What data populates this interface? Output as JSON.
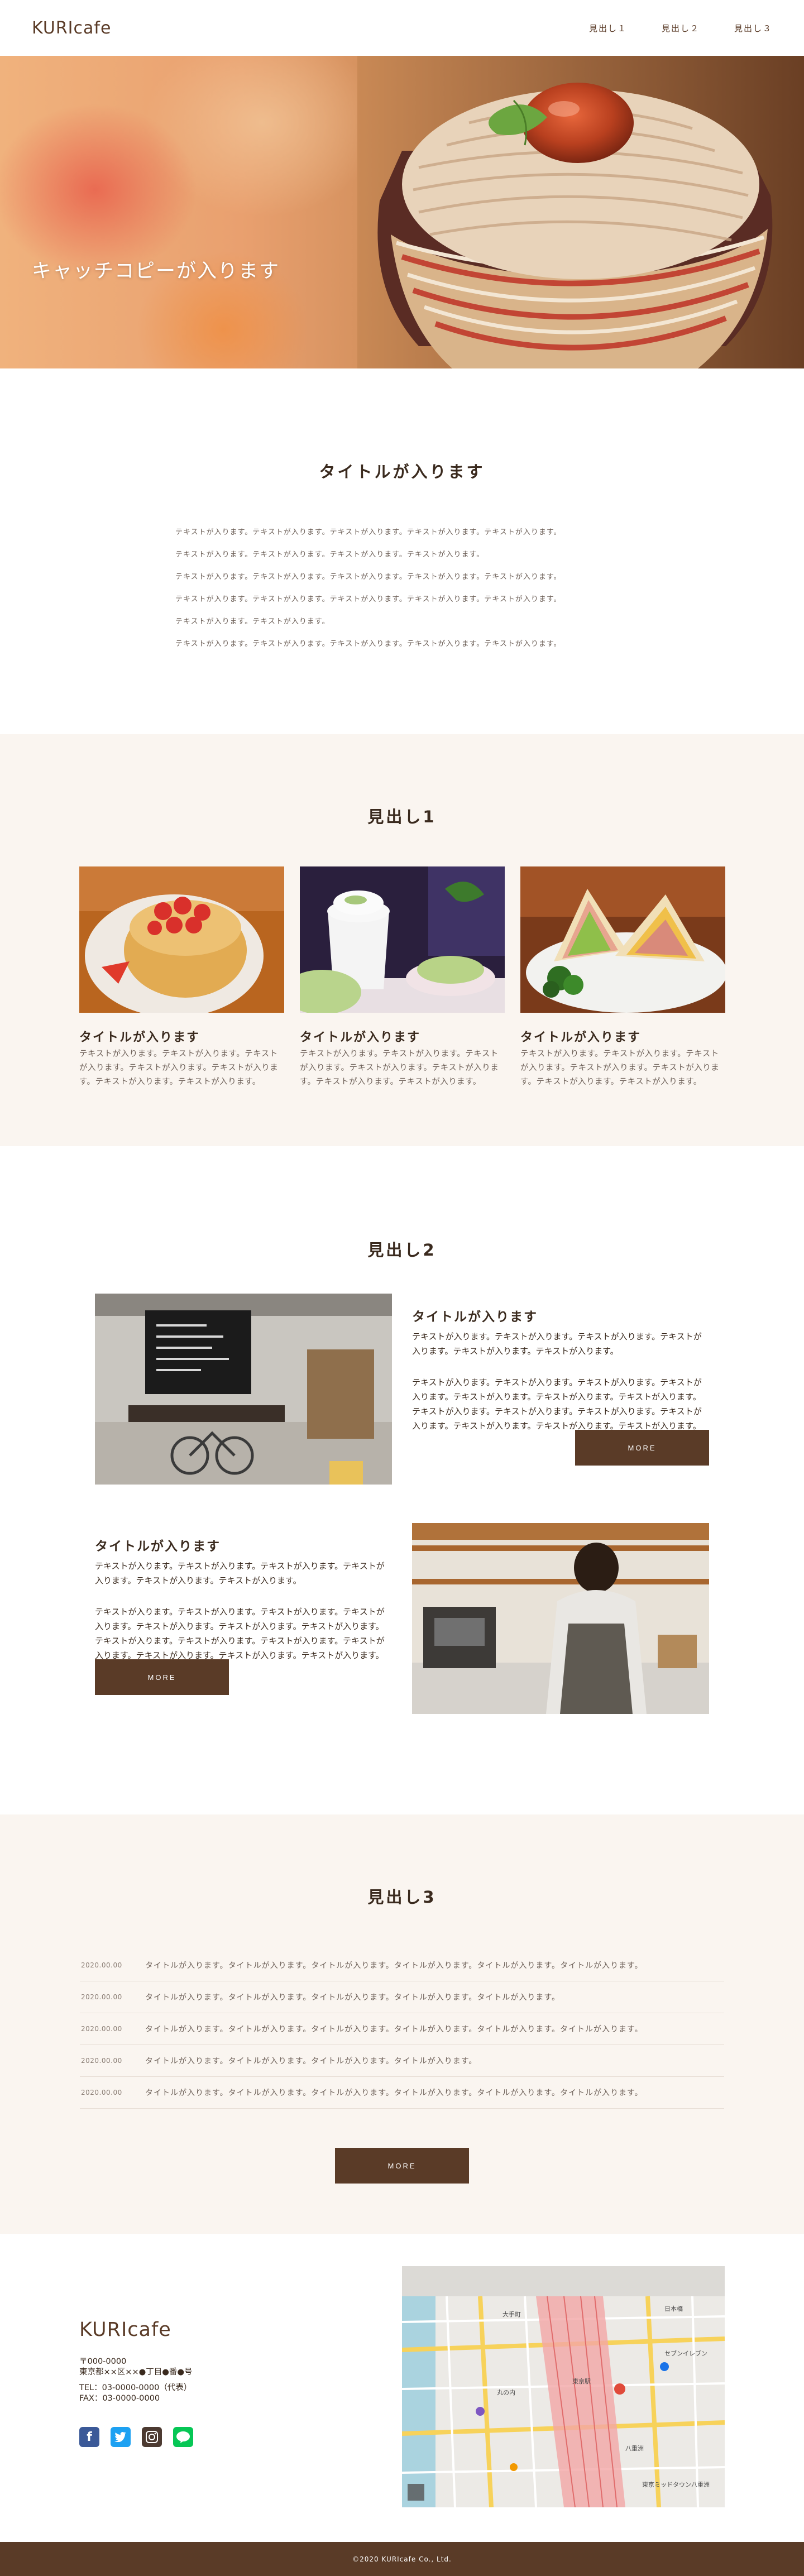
{
  "header": {
    "logo": "KURIcafe",
    "nav": [
      "見出し１",
      "見出し２",
      "見出し３"
    ]
  },
  "hero": {
    "catch": "キャッチコピーが入ります"
  },
  "intro": {
    "title": "タイトルが入ります",
    "lines": [
      "テキストが入ります。テキストが入ります。テキストが入ります。テキストが入ります。テキストが入ります。",
      "テキストが入ります。テキストが入ります。テキストが入ります。テキストが入ります。",
      "テキストが入ります。テキストが入ります。テキストが入ります。テキストが入ります。テキストが入ります。",
      "テキストが入ります。テキストが入ります。テキストが入ります。テキストが入ります。テキストが入ります。",
      "テキストが入ります。テキストが入ります。",
      "テキストが入ります。テキストが入ります。テキストが入ります。テキストが入ります。テキストが入ります。"
    ]
  },
  "sec1": {
    "title": "見出し1",
    "cards": [
      {
        "title": "タイトルが入ります",
        "text": "テキストが入ります。テキストが入ります。テキストが入ります。テキストが入ります。テキストが入ります。テキストが入ります。テキストが入ります。"
      },
      {
        "title": "タイトルが入ります",
        "text": "テキストが入ります。テキストが入ります。テキストが入ります。テキストが入ります。テキストが入ります。テキストが入ります。テキストが入ります。"
      },
      {
        "title": "タイトルが入ります",
        "text": "テキストが入ります。テキストが入ります。テキストが入ります。テキストが入ります。テキストが入ります。テキストが入ります。テキストが入ります。"
      }
    ]
  },
  "sec2": {
    "title": "見出し2",
    "features": [
      {
        "title": "タイトルが入ります",
        "text1": "テキストが入ります。テキストが入ります。テキストが入ります。テキストが入ります。テキストが入ります。テキストが入ります。",
        "text2": "テキストが入ります。テキストが入ります。テキストが入ります。テキストが入ります。テキストが入ります。テキストが入ります。テキストが入ります。テキストが入ります。テキストが入ります。テキストが入ります。テキストが入ります。テキストが入ります。テキストが入ります。テキストが入ります。",
        "button": "MORE"
      },
      {
        "title": "タイトルが入ります",
        "text1": "テキストが入ります。テキストが入ります。テキストが入ります。テキストが入ります。テキストが入ります。テキストが入ります。",
        "text2": "テキストが入ります。テキストが入ります。テキストが入ります。テキストが入ります。テキストが入ります。テキストが入ります。テキストが入ります。テキストが入ります。テキストが入ります。テキストが入ります。テキストが入ります。テキストが入ります。テキストが入ります。テキストが入ります。",
        "button": "MORE"
      }
    ]
  },
  "sec3": {
    "title": "見出し3",
    "news": [
      {
        "date": "2020.00.00",
        "title": "タイトルが入ります。タイトルが入ります。タイトルが入ります。タイトルが入ります。タイトルが入ります。タイトルが入ります。"
      },
      {
        "date": "2020.00.00",
        "title": "タイトルが入ります。タイトルが入ります。タイトルが入ります。タイトルが入ります。タイトルが入ります。"
      },
      {
        "date": "2020.00.00",
        "title": "タイトルが入ります。タイトルが入ります。タイトルが入ります。タイトルが入ります。タイトルが入ります。タイトルが入ります。"
      },
      {
        "date": "2020.00.00",
        "title": "タイトルが入ります。タイトルが入ります。タイトルが入ります。タイトルが入ります。"
      },
      {
        "date": "2020.00.00",
        "title": "タイトルが入ります。タイトルが入ります。タイトルが入ります。タイトルが入ります。タイトルが入ります。タイトルが入ります。"
      }
    ],
    "button": "MORE"
  },
  "footer": {
    "logo": "KURIcafe",
    "postal": "〒000-0000",
    "address": "東京都××区××●丁目●番●号",
    "tel": "TEL：03-0000-0000（代表）",
    "fax": "FAX：03-0000-0000",
    "icons": [
      "facebook-icon",
      "twitter-icon",
      "instagram-icon",
      "line-icon"
    ],
    "map_labels": [
      "東京駅",
      "日本橋",
      "八重洲",
      "丸の内",
      "大手町",
      "セブンイレブン",
      "東京ミッドタウン八重洲"
    ],
    "copyright": "©2020 KURIcafe Co., Ltd."
  },
  "colors": {
    "brand": "#5a3b27",
    "section_bg": "#faf5f0",
    "text": "#3a2a1e"
  }
}
